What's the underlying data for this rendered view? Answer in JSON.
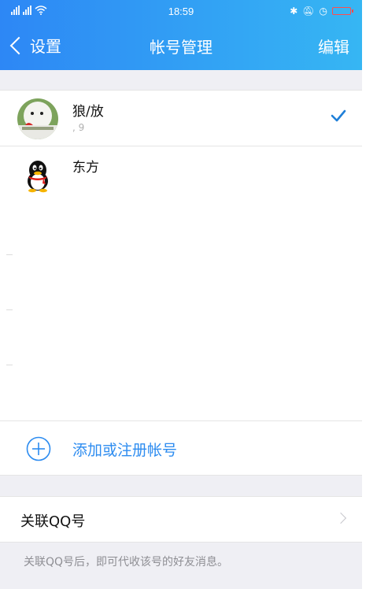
{
  "status_bar": {
    "time": "18:59",
    "signal_1": "5G",
    "signal_2": "4G"
  },
  "nav": {
    "back_label": "设置",
    "title": "帐号管理",
    "edit_label": "编辑"
  },
  "accounts": [
    {
      "name": "狼/放",
      "sub": ", 9",
      "selected": true,
      "avatar": "snowman-photo"
    },
    {
      "name": "东方",
      "sub": "",
      "selected": false,
      "avatar": "qq-penguin-icon"
    }
  ],
  "add_account": {
    "label": "添加或注册帐号",
    "icon": "plus-circle-icon"
  },
  "linked_qq": {
    "label": "关联QQ号",
    "note": "关联QQ号后，即可代收该号的好友消息。"
  },
  "colors": {
    "header_start": "#2d87f5",
    "header_end": "#36b6f3",
    "accent": "#2d8cf0",
    "check": "#1f7fd8"
  }
}
